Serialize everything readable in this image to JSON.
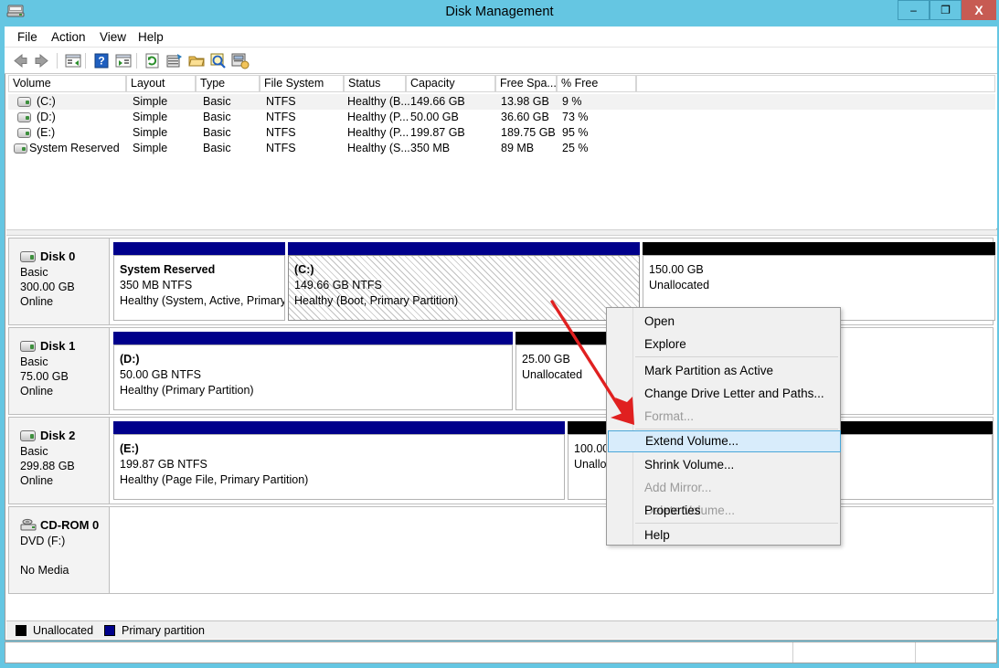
{
  "window": {
    "title": "Disk Management",
    "icon": "disk-management-icon",
    "controls": {
      "minimize": "–",
      "maximize": "❐",
      "close": "X"
    }
  },
  "menubar": {
    "items": [
      "File",
      "Action",
      "View",
      "Help"
    ]
  },
  "toolbar": {
    "icons": [
      "back-arrow-icon",
      "forward-arrow-icon",
      "up-one-level-icon",
      "help-icon",
      "show-hide-console-tree-icon",
      "refresh-icon",
      "properties-icon",
      "open-icon",
      "zoom-icon",
      "rescan-disks-icon"
    ]
  },
  "volume_list": {
    "columns": [
      "Volume",
      "Layout",
      "Type",
      "File System",
      "Status",
      "Capacity",
      "Free Spa...",
      "% Free"
    ],
    "rows": [
      {
        "volume": "(C:)",
        "layout": "Simple",
        "type": "Basic",
        "file_system": "NTFS",
        "status": "Healthy (B...",
        "capacity": "149.66 GB",
        "free_space": "13.98 GB",
        "percent_free": "9 %",
        "selected": true
      },
      {
        "volume": "(D:)",
        "layout": "Simple",
        "type": "Basic",
        "file_system": "NTFS",
        "status": "Healthy (P...",
        "capacity": "50.00 GB",
        "free_space": "36.60 GB",
        "percent_free": "73 %",
        "selected": false
      },
      {
        "volume": "(E:)",
        "layout": "Simple",
        "type": "Basic",
        "file_system": "NTFS",
        "status": "Healthy (P...",
        "capacity": "199.87 GB",
        "free_space": "189.75 GB",
        "percent_free": "95 %",
        "selected": false
      },
      {
        "volume": "System Reserved",
        "layout": "Simple",
        "type": "Basic",
        "file_system": "NTFS",
        "status": "Healthy (S...",
        "capacity": "350 MB",
        "free_space": "89 MB",
        "percent_free": "25 %",
        "selected": false
      }
    ]
  },
  "graphical_view": {
    "disks": [
      {
        "name": "Disk 0",
        "kind": "Basic",
        "size": "300.00 GB",
        "state": "Online",
        "partitions": [
          {
            "title": "System Reserved",
            "size_line": "350 MB NTFS",
            "status_line": "Healthy (System, Active, Primary",
            "bar": "primary",
            "selected": false
          },
          {
            "title": "(C:)",
            "size_line": "149.66 GB NTFS",
            "status_line": "Healthy (Boot, Primary Partition)",
            "bar": "primary",
            "selected": true
          },
          {
            "title": "",
            "size_line": "150.00 GB",
            "status_line": "Unallocated",
            "bar": "unalloc",
            "selected": false
          }
        ]
      },
      {
        "name": "Disk 1",
        "kind": "Basic",
        "size": "75.00 GB",
        "state": "Online",
        "partitions": [
          {
            "title": "(D:)",
            "size_line": "50.00 GB NTFS",
            "status_line": "Healthy (Primary Partition)",
            "bar": "primary",
            "selected": false
          },
          {
            "title": "",
            "size_line": "25.00 GB",
            "status_line": "Unallocated",
            "bar": "unalloc",
            "selected": false
          }
        ]
      },
      {
        "name": "Disk 2",
        "kind": "Basic",
        "size": "299.88 GB",
        "state": "Online",
        "partitions": [
          {
            "title": "(E:)",
            "size_line": "199.87 GB NTFS",
            "status_line": "Healthy (Page File, Primary Partition)",
            "bar": "primary",
            "selected": false
          },
          {
            "title": "",
            "size_line": "100.00 GB",
            "status_line": "Unallocated",
            "bar": "unalloc",
            "selected": false
          }
        ]
      },
      {
        "name": "CD-ROM 0",
        "kind": "DVD (F:)",
        "size": "",
        "state": "No Media",
        "partitions": []
      }
    ]
  },
  "legend": {
    "items": [
      {
        "label": "Unallocated",
        "color": "#000000"
      },
      {
        "label": "Primary partition",
        "color": "#00008b"
      }
    ]
  },
  "context_menu": {
    "items": [
      {
        "label": "Open",
        "state": "enabled"
      },
      {
        "label": "Explore",
        "state": "enabled"
      },
      {
        "label": "Mark Partition as Active",
        "state": "enabled"
      },
      {
        "label": "Change Drive Letter and Paths...",
        "state": "enabled"
      },
      {
        "label": "Format...",
        "state": "disabled"
      },
      {
        "label": "Extend Volume...",
        "state": "highlighted"
      },
      {
        "label": "Shrink Volume...",
        "state": "enabled"
      },
      {
        "label": "Add Mirror...",
        "state": "disabled"
      },
      {
        "label": "Delete Volume...",
        "state": "disabled"
      },
      {
        "label": "Properties",
        "state": "enabled"
      },
      {
        "label": "Help",
        "state": "enabled"
      }
    ]
  },
  "annotation": {
    "arrow_color": "#e02020"
  },
  "statusbar": {
    "text": ""
  }
}
